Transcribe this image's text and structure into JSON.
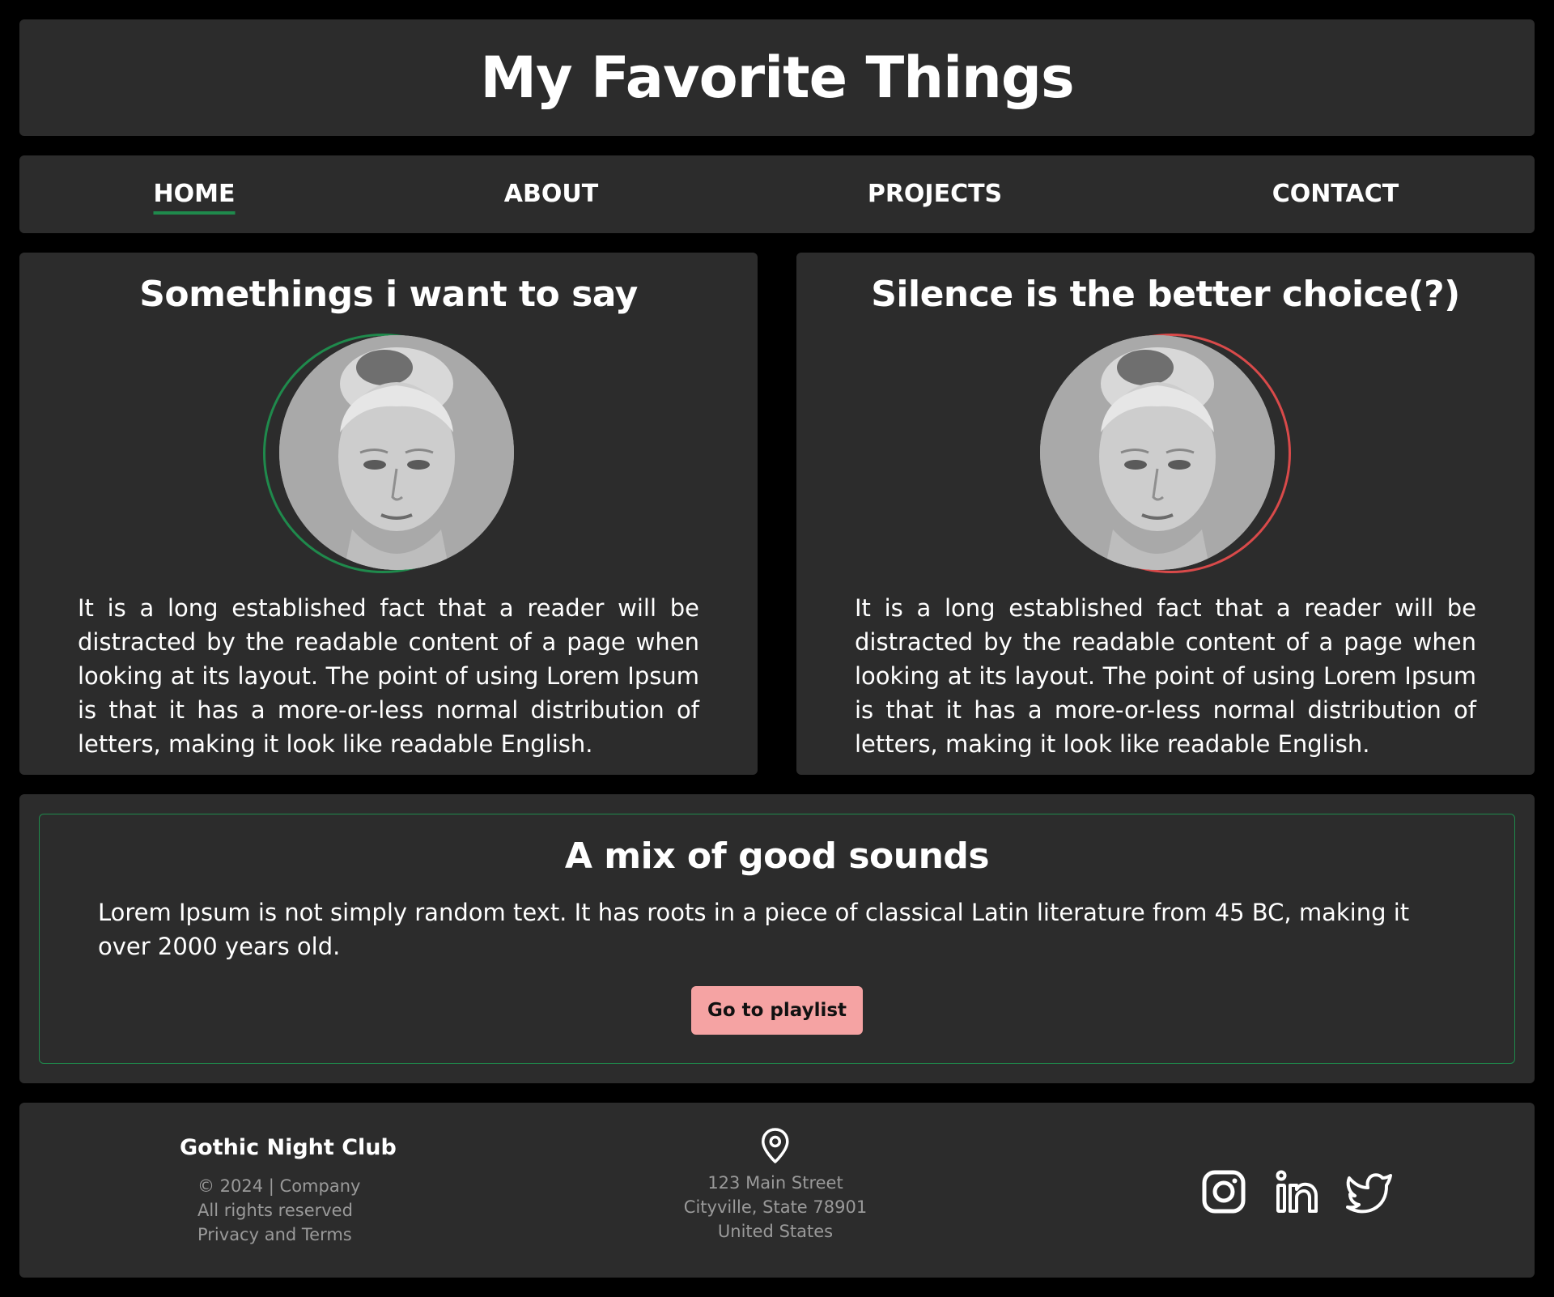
{
  "header": {
    "title": "My Favorite Things"
  },
  "nav": {
    "items": [
      {
        "label": "HOME",
        "active": true
      },
      {
        "label": "ABOUT",
        "active": false
      },
      {
        "label": "PROJECTS",
        "active": false
      },
      {
        "label": "CONTACT",
        "active": false
      }
    ]
  },
  "cards": [
    {
      "title": "Somethings i want to say",
      "ring_color": "#1f8a4c",
      "body": "It is a long established fact that a reader will be distracted by the readable content of a page when looking at its layout. The point of using Lorem Ipsum is that it has a more-or-less normal distribution of letters, making it look like readable English."
    },
    {
      "title": "Silence is the better choice(?)",
      "ring_color": "#d94a4a",
      "body": "It is a long established fact that a reader will be distracted by the readable content of a page when looking at its layout. The point of using Lorem Ipsum is that it has a more-or-less normal distribution of letters, making it look like readable English."
    }
  ],
  "sounds": {
    "title": "A mix of good sounds",
    "body": "Lorem Ipsum is not simply random text. It has roots in a piece of classical Latin literature from 45 BC, making it over 2000 years old.",
    "button_label": "Go to playlist",
    "button_color": "#f5a3a3"
  },
  "footer": {
    "brand": "Gothic Night Club",
    "legal": [
      "© 2024 | Company",
      "All rights reserved",
      "Privacy and Terms"
    ],
    "address": [
      "123 Main Street",
      "Cityville, State 78901",
      "United States"
    ],
    "socials": [
      "instagram-icon",
      "linkedin-icon",
      "twitter-icon"
    ]
  },
  "colors": {
    "background": "#000000",
    "panel": "#2c2c2c",
    "accent_green": "#1f8a4c",
    "accent_red": "#d94a4a",
    "muted_text": "#9a9a9a"
  }
}
